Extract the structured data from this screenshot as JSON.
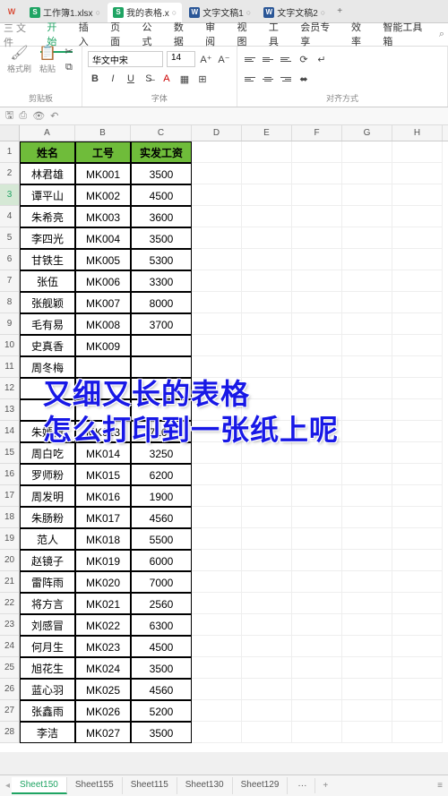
{
  "tabs": [
    {
      "type": "xls",
      "title": "工作簿1.xlsx"
    },
    {
      "type": "xls",
      "title": "我的表格.x",
      "active": true
    },
    {
      "type": "doc",
      "title": "文字文稿1"
    },
    {
      "type": "doc",
      "title": "文字文稿2"
    }
  ],
  "menu": {
    "pre": "三 文件",
    "items": [
      "开始",
      "插入",
      "页面",
      "公式",
      "数据",
      "审阅",
      "视图",
      "工具",
      "会员专享",
      "效率",
      "智能工具箱"
    ],
    "activeIndex": 0
  },
  "ribbon": {
    "formatPainter": "格式刷",
    "paste": "粘贴",
    "clipboardGroup": "剪贴板",
    "fontName": "华文中宋",
    "fontSize": "14",
    "fontGroup": "字体",
    "alignGroup": "对齐方式"
  },
  "columns": [
    "A",
    "B",
    "C",
    "D",
    "E",
    "F",
    "G",
    "H"
  ],
  "headerRow": {
    "name": "姓名",
    "id": "工号",
    "salary": "实发工资"
  },
  "selectedRow": 3,
  "rows": [
    {
      "n": "林君雄",
      "i": "MK001",
      "s": "3500"
    },
    {
      "n": "谭平山",
      "i": "MK002",
      "s": "4500"
    },
    {
      "n": "朱希亮",
      "i": "MK003",
      "s": "3600"
    },
    {
      "n": "李四光",
      "i": "MK004",
      "s": "3500"
    },
    {
      "n": "甘铁生",
      "i": "MK005",
      "s": "5300"
    },
    {
      "n": "张伍",
      "i": "MK006",
      "s": "3300"
    },
    {
      "n": "张舰颖",
      "i": "MK007",
      "s": "8000"
    },
    {
      "n": "毛有易",
      "i": "MK008",
      "s": "3700"
    },
    {
      "n": "史真香",
      "i": "MK009",
      "s": ""
    },
    {
      "n": "周冬梅",
      "i": "",
      "s": ""
    },
    {
      "n": "",
      "i": "",
      "s": ""
    },
    {
      "n": "",
      "i": "",
      "s": ""
    },
    {
      "n": "朱嫣粉",
      "i": "MK013",
      "s": "7100"
    },
    {
      "n": "周白吃",
      "i": "MK014",
      "s": "3250"
    },
    {
      "n": "罗师粉",
      "i": "MK015",
      "s": "6200"
    },
    {
      "n": "周发明",
      "i": "MK016",
      "s": "1900"
    },
    {
      "n": "朱肠粉",
      "i": "MK017",
      "s": "4560"
    },
    {
      "n": "范人",
      "i": "MK018",
      "s": "5500"
    },
    {
      "n": "赵镜子",
      "i": "MK019",
      "s": "6000"
    },
    {
      "n": "雷阵雨",
      "i": "MK020",
      "s": "7000"
    },
    {
      "n": "将方言",
      "i": "MK021",
      "s": "2560"
    },
    {
      "n": "刘感冒",
      "i": "MK022",
      "s": "6300"
    },
    {
      "n": "何月生",
      "i": "MK023",
      "s": "4500"
    },
    {
      "n": "旭花生",
      "i": "MK024",
      "s": "3500"
    },
    {
      "n": "蓝心羽",
      "i": "MK025",
      "s": "4560"
    },
    {
      "n": "张鑫雨",
      "i": "MK026",
      "s": "5200"
    },
    {
      "n": "李洁",
      "i": "MK027",
      "s": "3500"
    }
  ],
  "overlay": {
    "l1": "又细又长的表格",
    "l2": "怎么打印到一张纸上呢"
  },
  "sheets": {
    "items": [
      "Sheet150",
      "Sheet155",
      "Sheet115",
      "Sheet130",
      "Sheet129"
    ],
    "activeIndex": 0,
    "more": "···",
    "add": "+"
  }
}
